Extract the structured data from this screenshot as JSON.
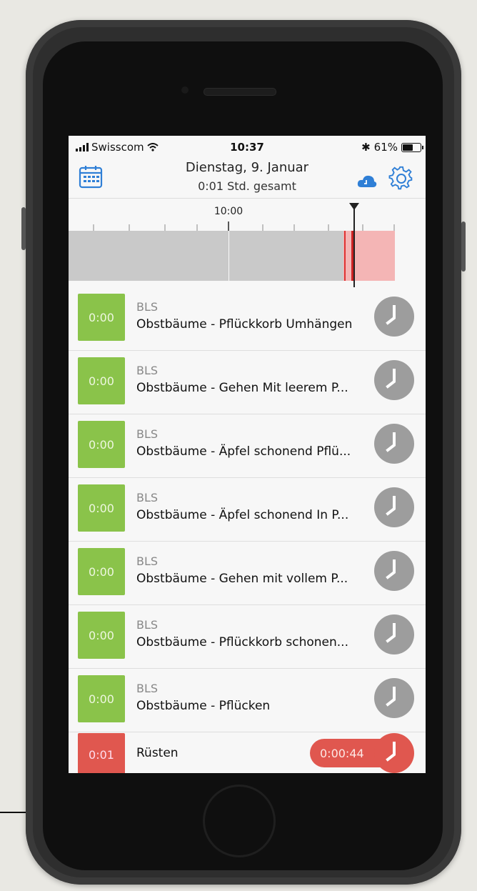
{
  "status_bar": {
    "carrier": "Swisscom",
    "time": "10:37",
    "bluetooth": "✱",
    "battery": "61%",
    "battery_level": 0.61
  },
  "header": {
    "date": "Dienstag, 9. Januar",
    "total": "0:01 Std. gesamt"
  },
  "timeline": {
    "label": "10:00"
  },
  "items": [
    {
      "badge": "0:00",
      "category": "BLS",
      "title": "Obstbäume - Pflückkorb Umhängen"
    },
    {
      "badge": "0:00",
      "category": "BLS",
      "title": "Obstbäume - Gehen Mit leerem P..."
    },
    {
      "badge": "0:00",
      "category": "BLS",
      "title": "Obstbäume - Äpfel schonend Pflü..."
    },
    {
      "badge": "0:00",
      "category": "BLS",
      "title": "Obstbäume - Äpfel schonend In P..."
    },
    {
      "badge": "0:00",
      "category": "BLS",
      "title": "Obstbäume - Gehen mit vollem P..."
    },
    {
      "badge": "0:00",
      "category": "BLS",
      "title": "Obstbäume - Pflückkorb schonen..."
    },
    {
      "badge": "0:00",
      "category": "BLS",
      "title": "Obstbäume - Pflücken"
    }
  ],
  "running": {
    "badge": "0:01",
    "title": "Rüsten",
    "elapsed": "0:00:44"
  },
  "colors": {
    "green": "#8ac34a",
    "red": "#e0574f",
    "grey_button": "#9d9d9d",
    "accent_blue": "#2f7fd6"
  },
  "icons": [
    "calendar-icon",
    "cloud-icon",
    "gear-icon",
    "clock-icon"
  ]
}
